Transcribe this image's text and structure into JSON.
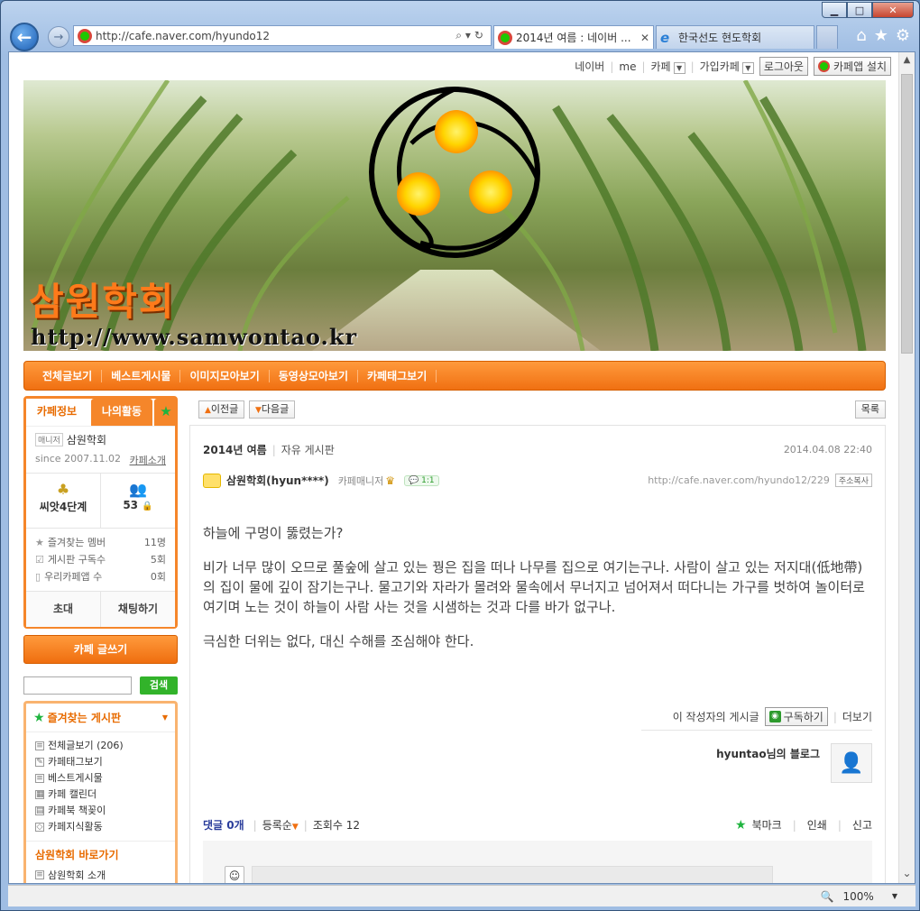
{
  "browser": {
    "address": "http://cafe.naver.com/hyundo12",
    "tabs": [
      {
        "label": "2014년 여름 : 네이버 ..."
      },
      {
        "label": "한국선도 현도학회"
      }
    ],
    "zoom": "100%"
  },
  "gnb": {
    "naver": "네이버",
    "me": "me",
    "cafe": "카페",
    "joined": "가입카페",
    "logout": "로그아웃",
    "app": "카페앱 설치"
  },
  "banner": {
    "title": "삼원학회",
    "url": "http://www.samwontao.kr"
  },
  "menu": [
    "전체글보기",
    "베스트게시물",
    "이미지모아보기",
    "동영상모아보기",
    "카페태그보기"
  ],
  "cafe_info": {
    "tabs": [
      "카페정보",
      "나의활동"
    ],
    "manager_tag": "매니저",
    "manager_name": "삼원학회",
    "since": "since 2007.11.02",
    "intro": "카페소개",
    "level": "씨앗4단계",
    "members": "53",
    "stats": [
      {
        "label": "즐겨찾는 멤버",
        "value": "11명"
      },
      {
        "label": "게시판 구독수",
        "value": "5회"
      },
      {
        "label": "우리카페앱 수",
        "value": "0회"
      }
    ],
    "invite": "초대",
    "chat": "채팅하기"
  },
  "write_button": "카페 글쓰기",
  "search_button": "검색",
  "favorites": {
    "title": "즐겨찾는 게시판",
    "items": [
      "전체글보기 (206)",
      "카페태그보기",
      "베스트게시물",
      "카페 캘린더",
      "카페북 책꽂이",
      "카페지식활동"
    ],
    "shortcut_title": "삼원학회 바로가기",
    "shortcut_items": [
      "삼원학회 소개"
    ]
  },
  "article": {
    "prev": "이전글",
    "next": "다음글",
    "list": "목록",
    "title": "2014년 여름",
    "board": "자유 게시판",
    "date": "2014.04.08 22:40",
    "author": "삼원학회(hyun****)",
    "role": "카페매니저",
    "comment_count_badge": "1:1",
    "link": "http://cafe.naver.com/hyundo12/229",
    "copy": "주소복사",
    "paragraphs": [
      "하늘에 구멍이 뚫렸는가?",
      "비가 너무 많이 오므로 풀숲에 살고 있는 꿩은 집을 떠나 나무를 집으로 여기는구나. 사람이 살고 있는 저지대(低地帶)의 집이 물에 깊이 잠기는구나. 물고기와 자라가 몰려와 물속에서 무너지고 넘어져서 떠다니는 가구를 벗하여 놀이터로 여기며 노는 것이 하늘이 사람 사는 것을 시샘하는 것과 다를 바가 없구나.",
      "극심한 더위는 없다, 대신 수해를 조심해야 한다."
    ],
    "writer_posts": "이 작성자의 게시글",
    "subscribe": "구독하기",
    "more": "더보기",
    "blog": "hyuntao님의 블로그",
    "comments_label": "댓글",
    "comments_count": "0개",
    "order": "등록순",
    "views": "조회수 12",
    "bookmark": "북마크",
    "print": "인쇄",
    "report": "신고"
  }
}
